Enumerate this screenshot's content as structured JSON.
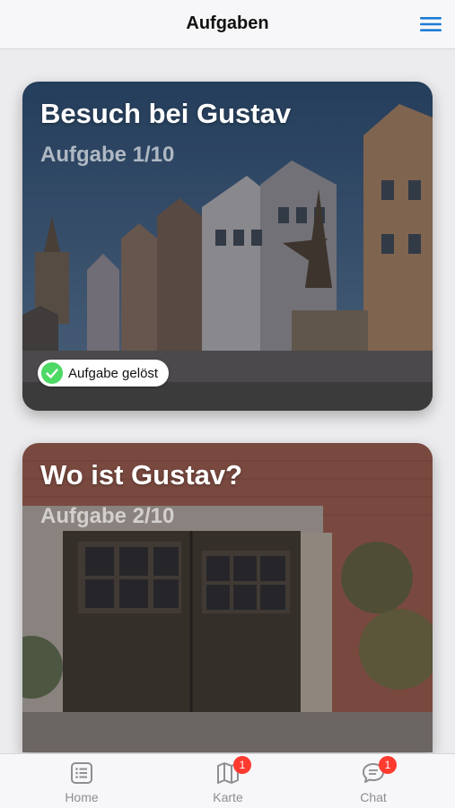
{
  "header": {
    "title": "Aufgaben",
    "menu_icon": "hamburger-menu-icon"
  },
  "tasks": [
    {
      "title": "Besuch bei Gustav",
      "subtitle": "Aufgabe 1/10",
      "status": "Aufgabe gelöst",
      "status_icon": "check-icon",
      "status_color": "#4cd964"
    },
    {
      "title": "Wo ist Gustav?",
      "subtitle": "Aufgabe 2/10"
    }
  ],
  "tabbar": {
    "home": {
      "label": "Home",
      "icon": "list-icon"
    },
    "karte": {
      "label": "Karte",
      "icon": "map-icon",
      "badge": "1"
    },
    "chat": {
      "label": "Chat",
      "icon": "chat-icon",
      "badge": "1"
    }
  },
  "colors": {
    "accent": "#1e7cd6",
    "badge": "#ff3b30",
    "success": "#4cd964",
    "tab_inactive": "#8e8e93"
  }
}
